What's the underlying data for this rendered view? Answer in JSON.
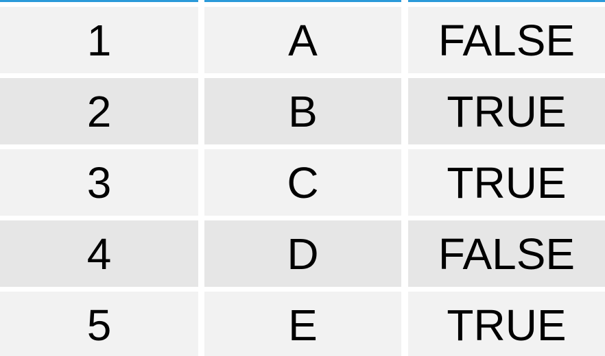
{
  "table": {
    "rows": [
      {
        "num": "1",
        "letter": "A",
        "flag": "FALSE"
      },
      {
        "num": "2",
        "letter": "B",
        "flag": "TRUE"
      },
      {
        "num": "3",
        "letter": "C",
        "flag": "TRUE"
      },
      {
        "num": "4",
        "letter": "D",
        "flag": "FALSE"
      },
      {
        "num": "5",
        "letter": "E",
        "flag": "TRUE"
      }
    ]
  },
  "colors": {
    "accent": "#2b9ad9",
    "row_odd": "#f2f2f2",
    "row_even": "#e6e6e6"
  }
}
